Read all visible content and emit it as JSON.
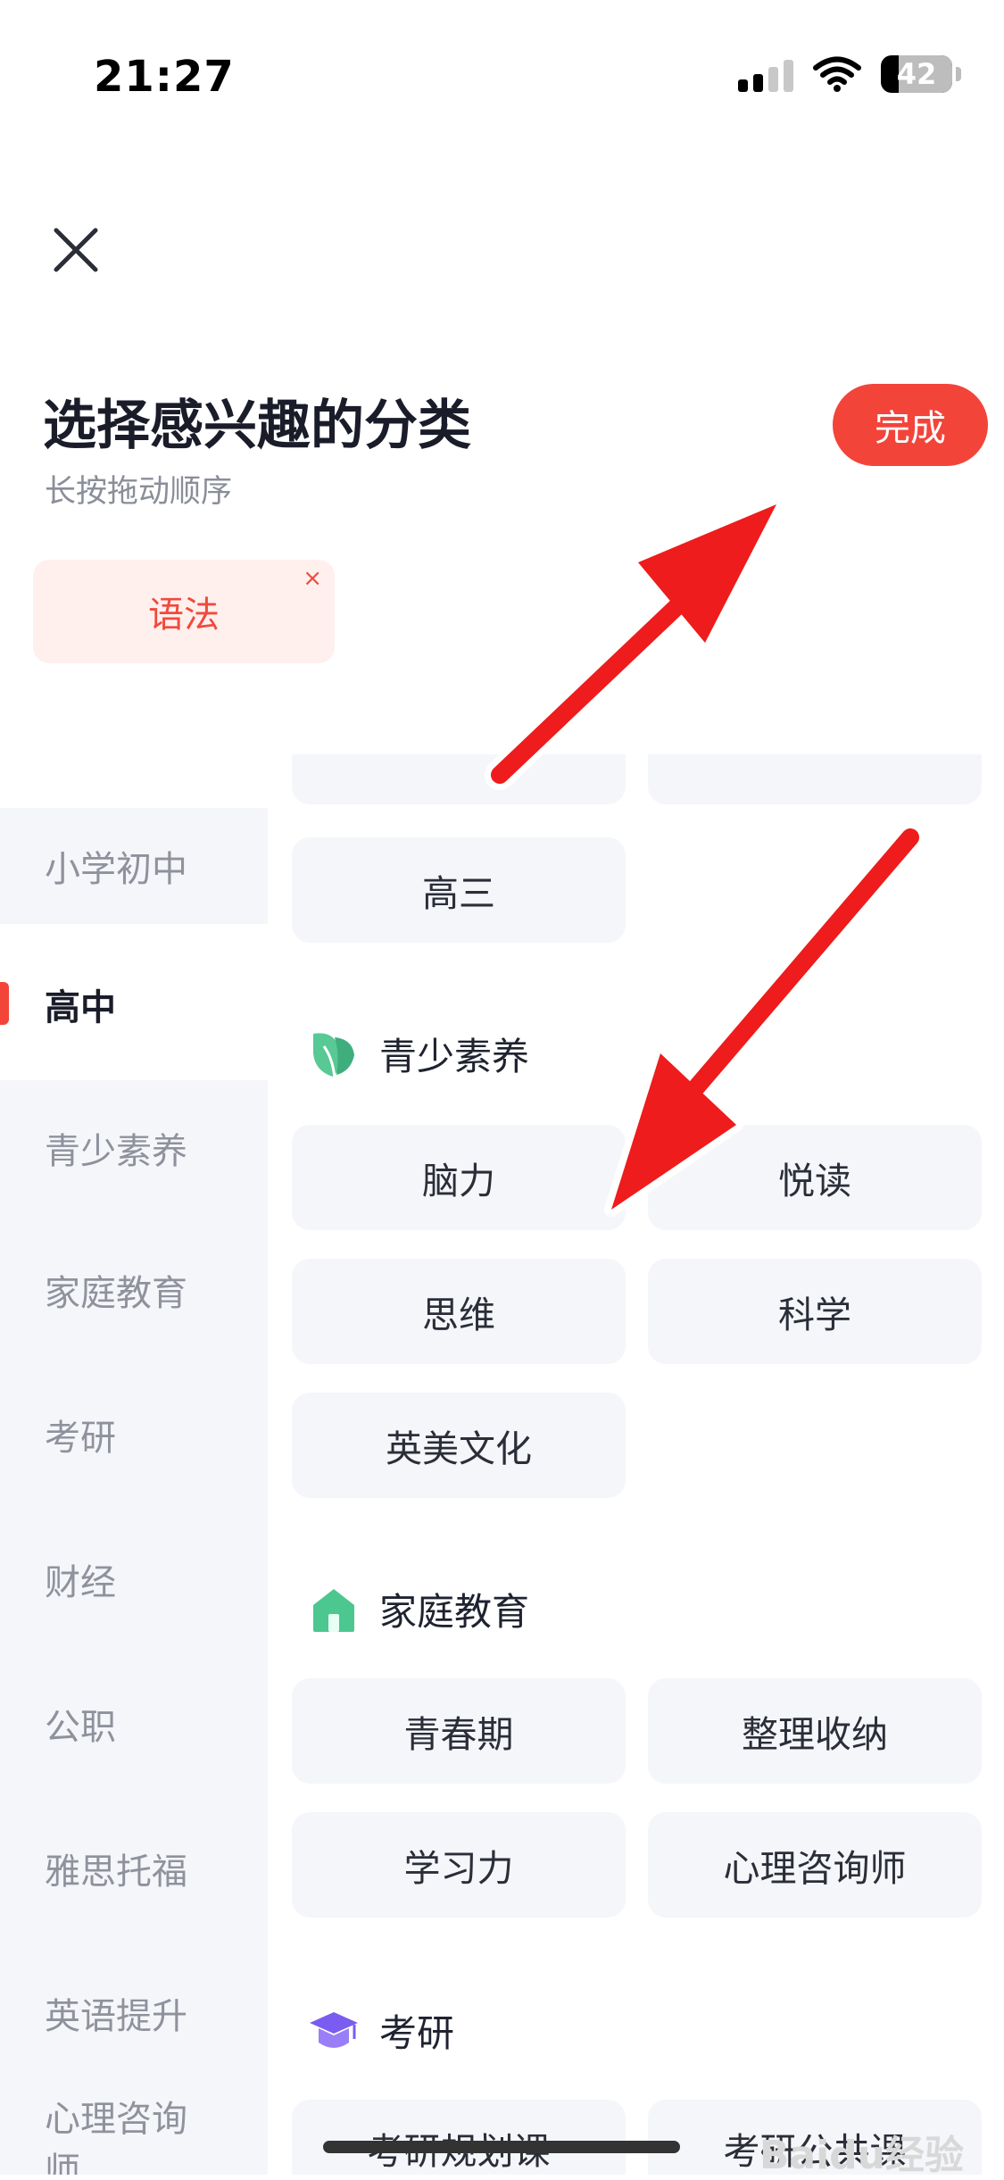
{
  "status_bar": {
    "time": "21:27",
    "battery": "42"
  },
  "header": {
    "title": "选择感兴趣的分类",
    "subtitle": "长按拖动顺序",
    "done_label": "完成"
  },
  "selected": [
    {
      "label": "语法",
      "remove": "×"
    }
  ],
  "sidebar": {
    "items": [
      {
        "label": "小学初中"
      },
      {
        "label": "高中",
        "active": true
      },
      {
        "label": "青少素养"
      },
      {
        "label": "家庭教育"
      },
      {
        "label": "考研"
      },
      {
        "label": "财经"
      },
      {
        "label": "公职"
      },
      {
        "label": "雅思托福"
      },
      {
        "label": "英语提升"
      },
      {
        "label": "心理咨询师"
      }
    ]
  },
  "content": {
    "gaosan_chip": "高三",
    "sections": [
      {
        "title": "青少素养",
        "icon": "leaf-icon",
        "chips": [
          "脑力",
          "悦读",
          "思维",
          "科学",
          "英美文化"
        ]
      },
      {
        "title": "家庭教育",
        "icon": "house-icon",
        "chips": [
          "青春期",
          "整理收纳",
          "学习力",
          "心理咨询师"
        ]
      },
      {
        "title": "考研",
        "icon": "graduation-cap-icon",
        "chips": [
          "考研规划课",
          "考研公共课"
        ]
      }
    ]
  },
  "watermark": "Baidu经验",
  "colors": {
    "accent": "#f3443a",
    "chip_bg": "#f5f6fa",
    "selected_bg": "#fff0ed"
  }
}
